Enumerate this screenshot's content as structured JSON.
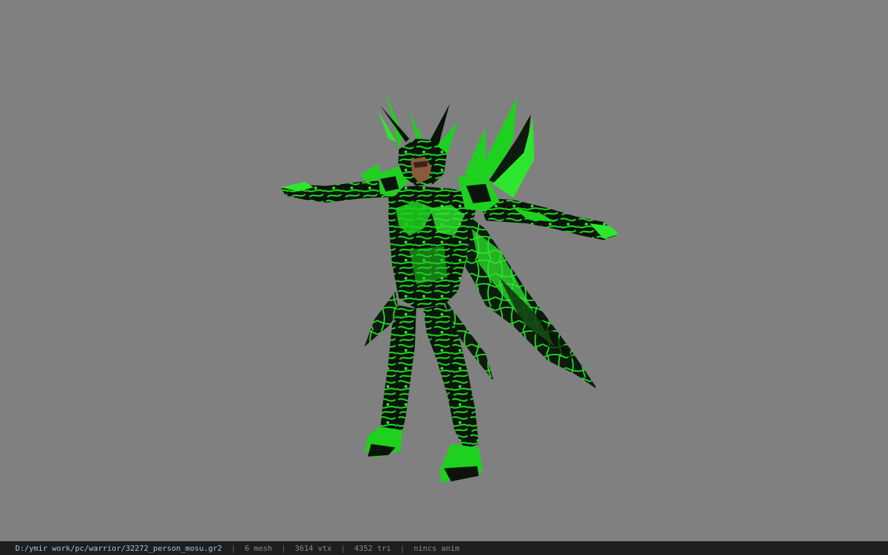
{
  "viewport": {
    "background": "#808080",
    "model": {
      "icon": "green-armored-warrior-model",
      "armor_color": "#1fd11f",
      "armor_dark_color": "#0a140a",
      "skin_color": "#8a5a3c"
    }
  },
  "status_bar": {
    "file_path": "D:/ymir work/pc/warrior/32272_person_mosu.gr2",
    "separator": "|",
    "mesh_count": "6 mesh",
    "vertex_count": "3614 vtx",
    "triangle_count": "4352 tri",
    "animation": "nincs anim"
  }
}
